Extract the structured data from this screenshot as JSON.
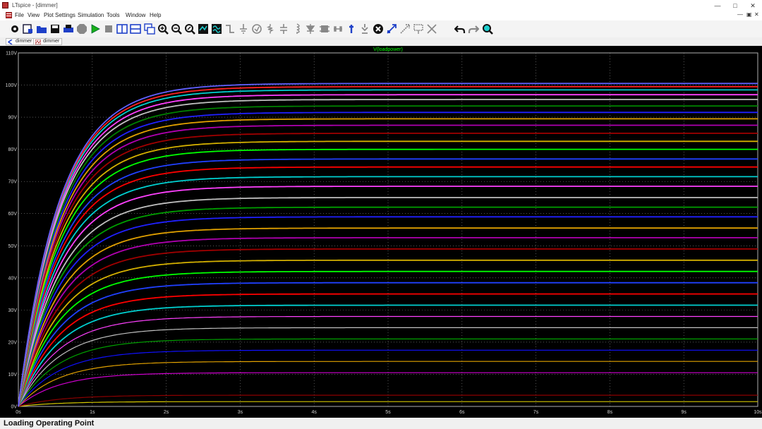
{
  "window": {
    "title": "LTspice - [dimmer]",
    "controls": {
      "minimize": "—",
      "maximize": "□",
      "close": "✕"
    }
  },
  "menu": {
    "items": [
      "File",
      "View",
      "Plot Settings",
      "Simulation",
      "Tools",
      "Window",
      "Help"
    ],
    "mdi_controls": [
      "—",
      "▣",
      "✕"
    ]
  },
  "toolbar": {
    "icons": [
      "control-panel-icon",
      "new-schematic-icon",
      "open-icon",
      "save-icon",
      "print-icon",
      "halt-icon",
      "run-icon",
      "stop-icon",
      "tile-vertical-icon",
      "tile-horizontal-icon",
      "cascade-icon",
      "zoom-in-icon",
      "zoom-out-icon",
      "zoom-fit-icon",
      "zoom-area-icon",
      "autorange-icon",
      "wire-icon",
      "ground-icon",
      "label-net-icon",
      "resistor-icon",
      "capacitor-icon",
      "inductor-icon",
      "diode-icon",
      "component-icon",
      "move-icon",
      "text-icon",
      "spice-directive-icon",
      "delete-icon",
      "duplicate-icon",
      "drag-icon",
      "rotate-icon",
      "mirror-icon",
      "undo-icon",
      "redo-icon",
      "find-icon"
    ]
  },
  "tabs": [
    {
      "label": "dimmer",
      "icon": "schematic-icon"
    },
    {
      "label": "dimmer",
      "icon": "waveform-icon"
    }
  ],
  "chart_data": {
    "type": "line",
    "title": "V(loadpower)",
    "xlabel": "",
    "ylabel": "",
    "xlim": [
      0,
      10
    ],
    "ylim": [
      0,
      110
    ],
    "x_ticks": [
      "0s",
      "1s",
      "2s",
      "3s",
      "4s",
      "5s",
      "6s",
      "7s",
      "8s",
      "9s",
      "10s"
    ],
    "y_ticks": [
      "0V",
      "10V",
      "20V",
      "30V",
      "40V",
      "50V",
      "60V",
      "70V",
      "80V",
      "90V",
      "100V",
      "110V"
    ],
    "time_constant_s": 0.55,
    "series_steady_state_V": [
      1.5,
      3.5,
      10.5,
      14,
      17.5,
      21,
      24.5,
      28,
      31.5,
      35,
      38.5,
      42,
      45.5,
      49,
      52.5,
      55.5,
      59,
      62,
      65,
      68.5,
      71.5,
      74.5,
      77,
      80,
      82.5,
      85,
      87.5,
      89.5,
      91.5,
      93.5,
      95.5,
      97,
      98.5,
      99.5,
      100.5
    ],
    "series_colors": [
      "#d4c800",
      "#8b0000",
      "#d000d0",
      "#e0a000",
      "#1010ff",
      "#00a000",
      "#c0c0c0",
      "#ff40ff",
      "#00d0d0",
      "#ff0000",
      "#2040ff",
      "#00ff00",
      "#d4b000",
      "#a00000",
      "#b000b0",
      "#e0a000",
      "#2020ff",
      "#00a000",
      "#c0c0c0",
      "#ff40ff",
      "#00d0d0",
      "#ff0000",
      "#2040ff",
      "#00ff00",
      "#d4b000",
      "#a00000",
      "#b000b0",
      "#e0a000",
      "#2020ff",
      "#008000",
      "#c0c0c0",
      "#ff40ff",
      "#00d0d0",
      "#ff2020",
      "#6060ff"
    ],
    "grid": true,
    "grid_color": "#8a8a8a",
    "title_color": "#00ff00"
  },
  "status": {
    "text": "Loading Operating Point"
  }
}
